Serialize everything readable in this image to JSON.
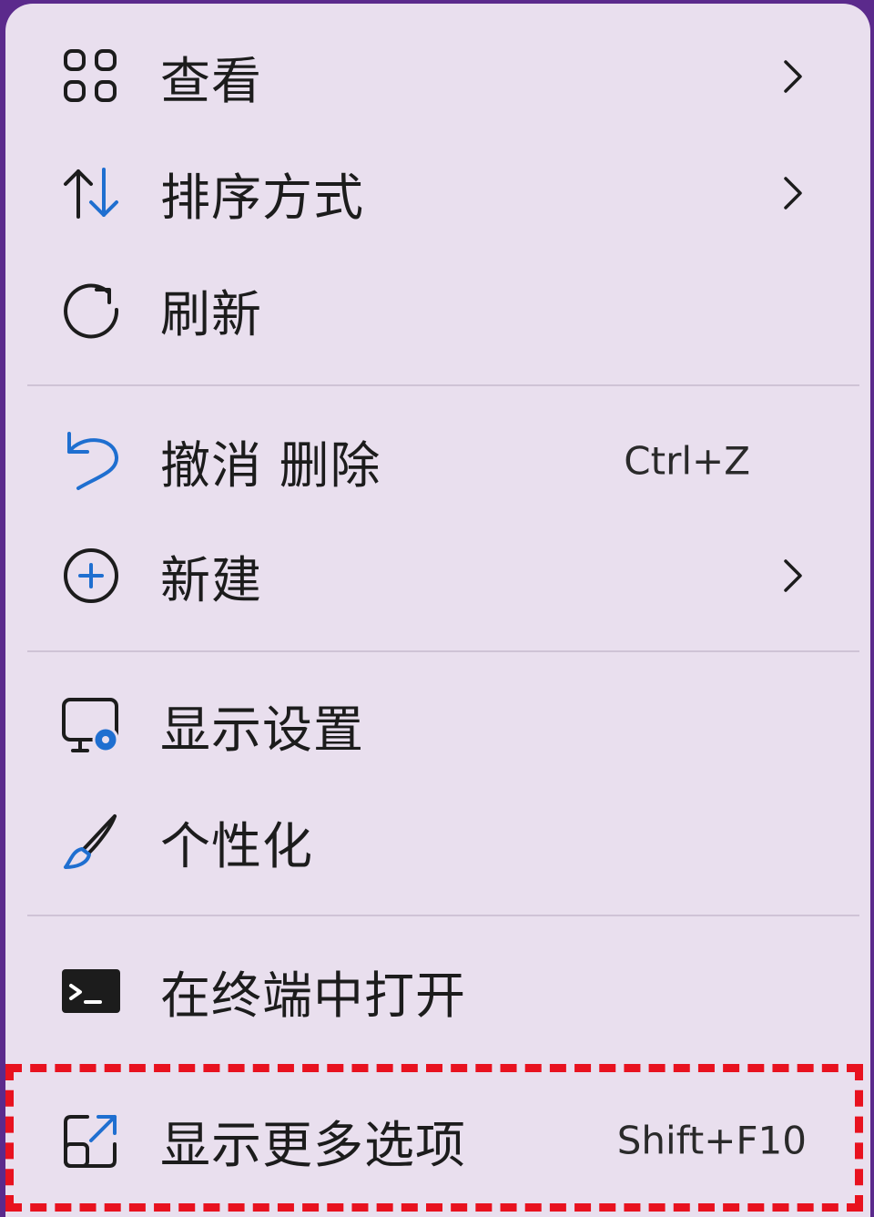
{
  "menu": {
    "items": [
      {
        "label": "查看",
        "icon": "grid-icon",
        "has_submenu": true
      },
      {
        "label": "排序方式",
        "icon": "sort-icon",
        "has_submenu": true
      },
      {
        "label": "刷新",
        "icon": "refresh-icon",
        "has_submenu": false
      },
      {
        "label": "撤消 删除",
        "icon": "undo-icon",
        "shortcut": "Ctrl+Z"
      },
      {
        "label": "新建",
        "icon": "add-icon",
        "has_submenu": true
      },
      {
        "label": "显示设置",
        "icon": "display-settings-icon"
      },
      {
        "label": "个性化",
        "icon": "brush-icon"
      },
      {
        "label": "在终端中打开",
        "icon": "terminal-icon"
      },
      {
        "label": "显示更多选项",
        "icon": "more-options-icon",
        "shortcut": "Shift+F10",
        "highlighted": true
      }
    ]
  },
  "colors": {
    "background": "#5b2a8c",
    "menu_background": "#e9dfee",
    "accent_blue": "#1f6fd0",
    "highlight_red": "#e8121f"
  }
}
